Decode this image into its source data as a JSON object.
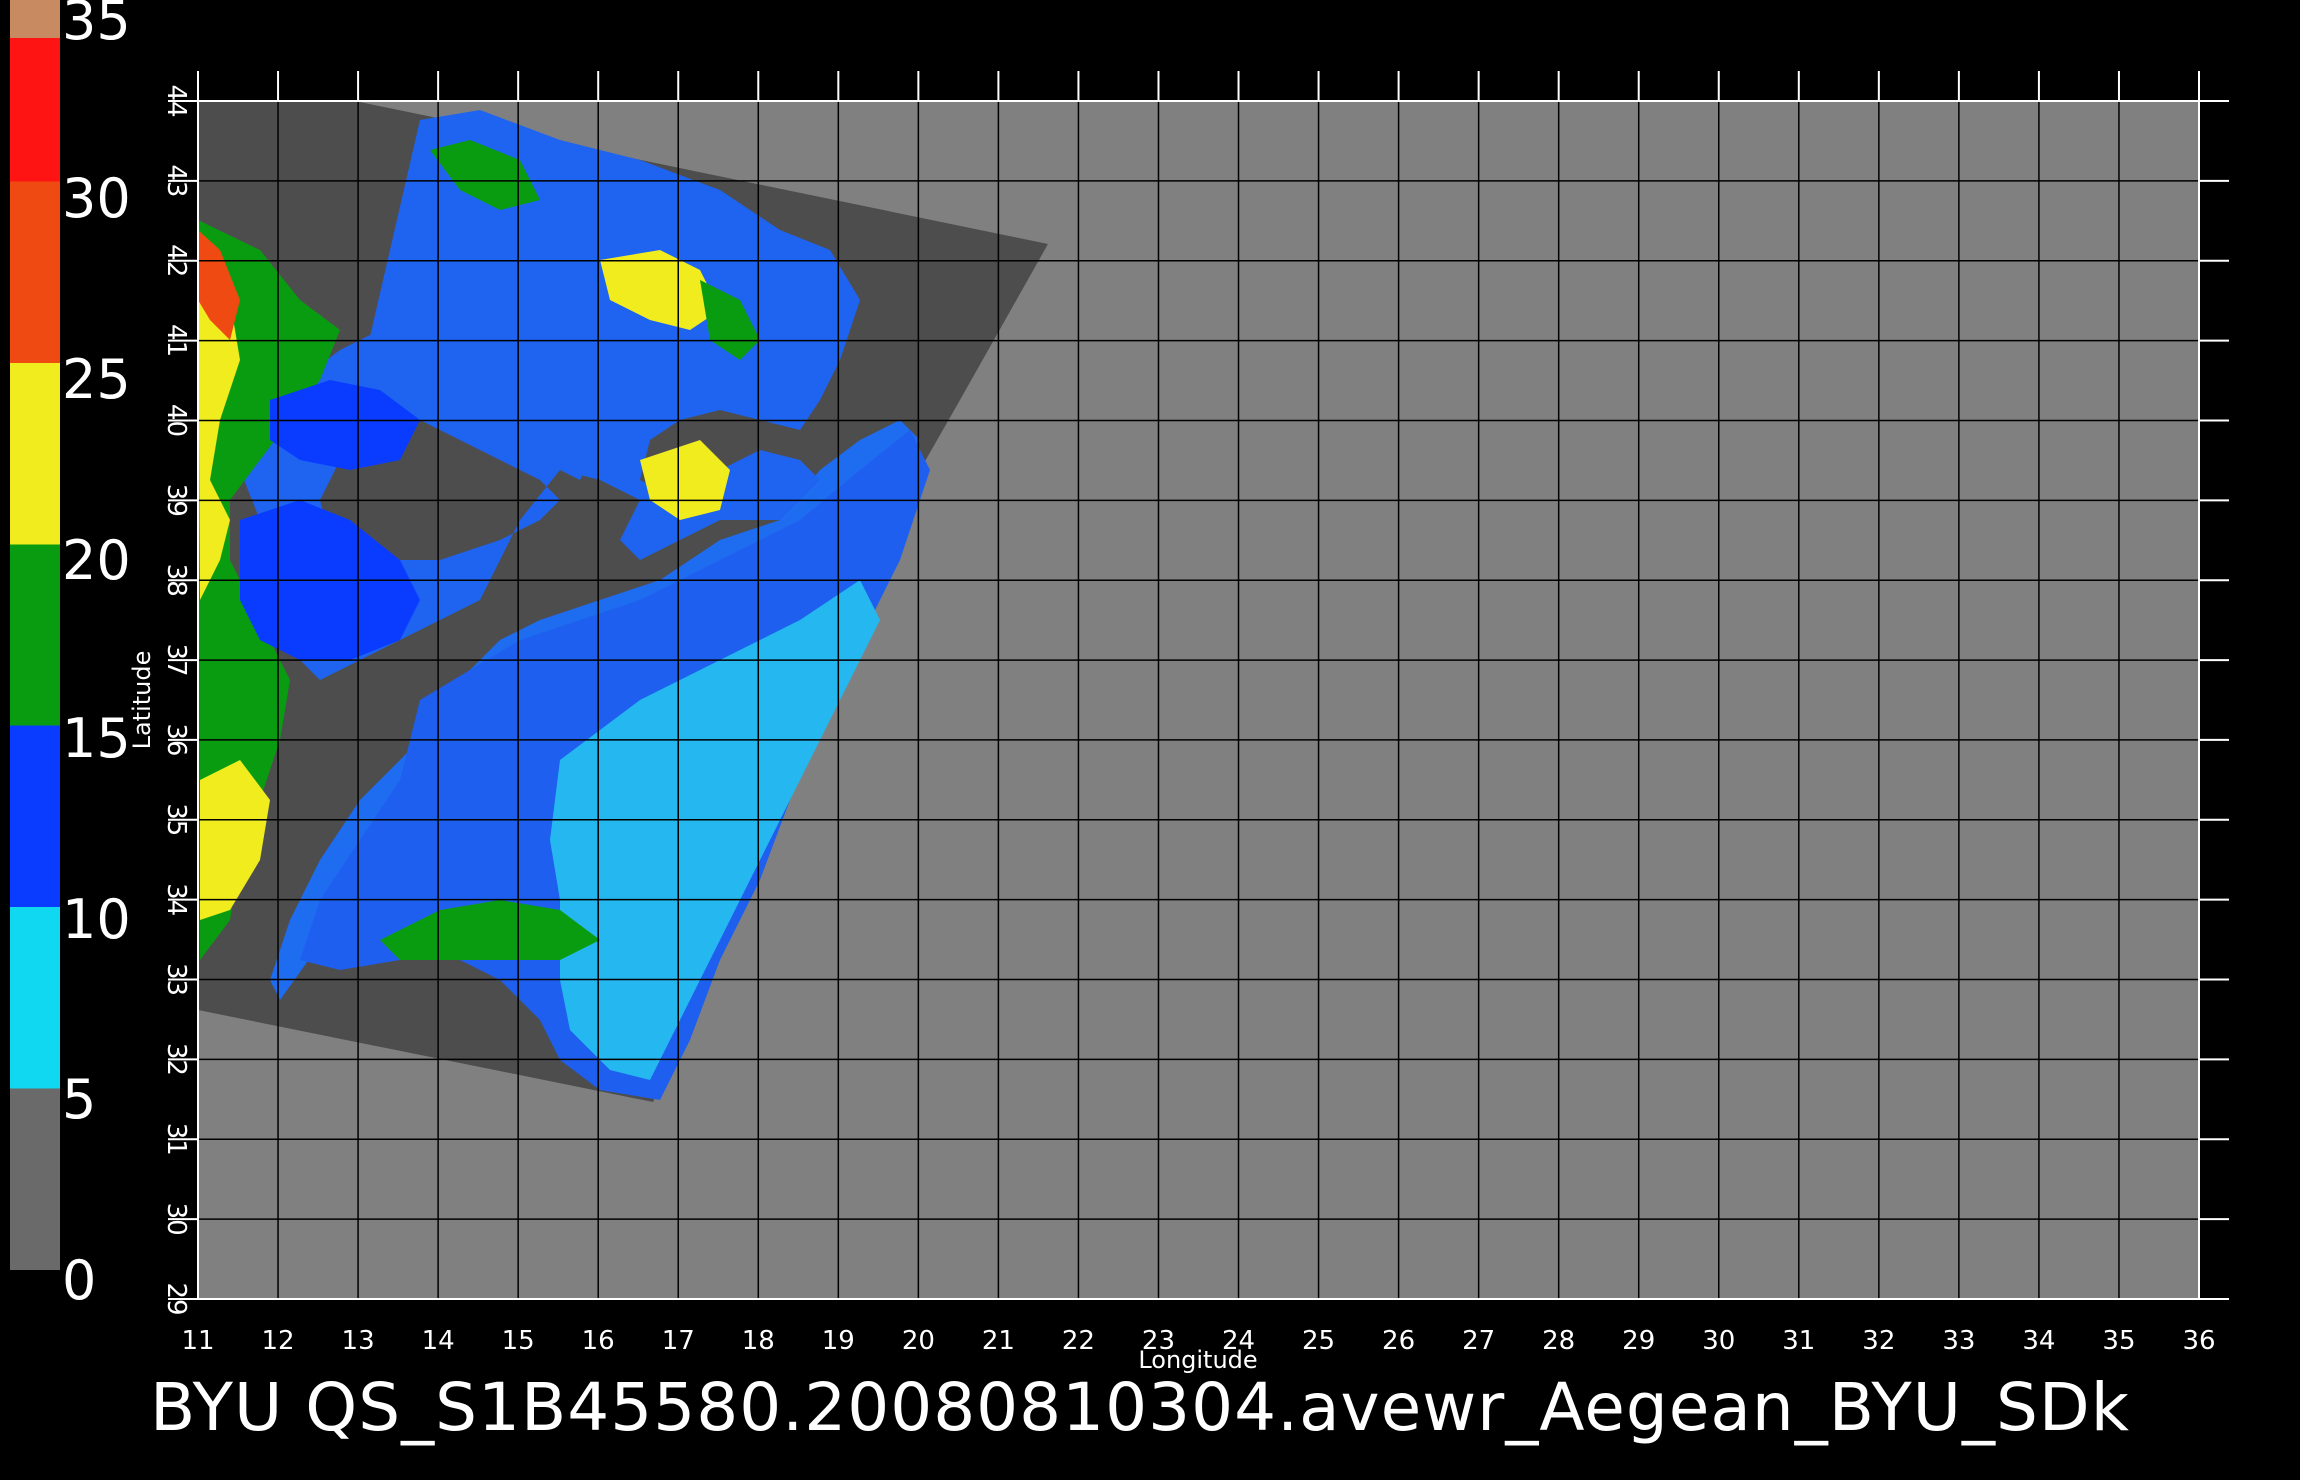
{
  "colorbar": {
    "labels": [
      "35",
      "30",
      "25",
      "20",
      "15",
      "10",
      "5",
      "0"
    ],
    "stops": [
      {
        "from": 0,
        "to": 5,
        "color": "#6a6a6a"
      },
      {
        "from": 5,
        "to": 10,
        "color": "#10d8f0"
      },
      {
        "from": 10,
        "to": 15,
        "color": "#0a3cff"
      },
      {
        "from": 15,
        "to": 20,
        "color": "#0a9c10"
      },
      {
        "from": 20,
        "to": 25,
        "color": "#f0ec1e"
      },
      {
        "from": 25,
        "to": 30,
        "color": "#ee4a12"
      },
      {
        "from": 30,
        "to": 35,
        "color": "#ff1414"
      }
    ]
  },
  "axes": {
    "xlabel": "Longitude",
    "ylabel": "Latitude",
    "x_ticks": [
      "11",
      "12",
      "13",
      "14",
      "15",
      "16",
      "17",
      "18",
      "19",
      "20",
      "21",
      "22",
      "23",
      "24",
      "25",
      "26",
      "27",
      "28",
      "29",
      "30",
      "31",
      "32",
      "33",
      "34",
      "35",
      "36"
    ],
    "y_ticks": [
      "29",
      "30",
      "31",
      "32",
      "33",
      "34",
      "35",
      "36",
      "37",
      "38",
      "39",
      "40",
      "41",
      "42",
      "43",
      "44"
    ],
    "x_range": [
      11,
      36
    ],
    "y_range": [
      29,
      44
    ]
  },
  "colors": {
    "background": "#000000",
    "no_data": "#808080",
    "land": "#4d4d4d",
    "grid": "#000000"
  },
  "footer": {
    "title": "BYU  QS_S1B45580.20080810304.avewr_Aegean_BYU_SDk"
  }
}
